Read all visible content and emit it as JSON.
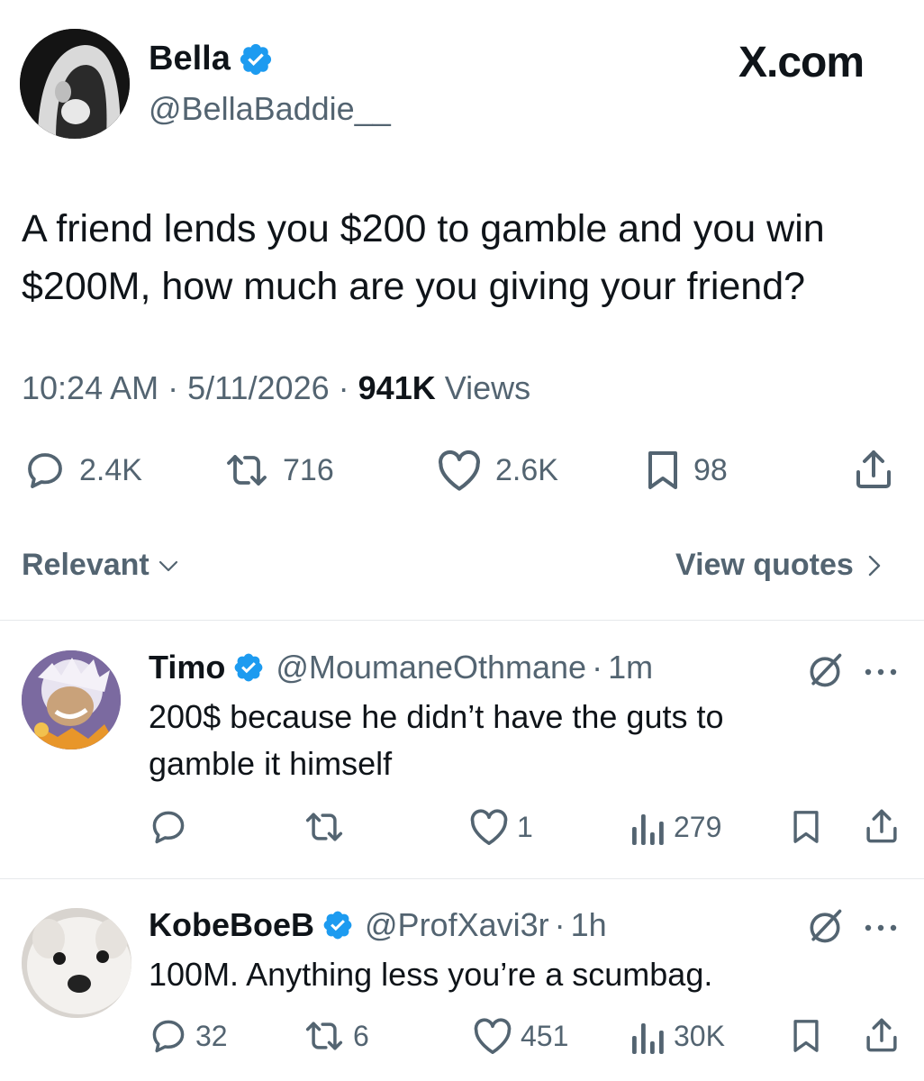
{
  "site": "X.com",
  "tweet": {
    "author_name": "Bella",
    "handle": "@BellaBaddie__",
    "text_line1": "A friend lends you $200 to gamble and you win",
    "text_line2": "$200M, how much are you giving your friend?",
    "time": "10:24 AM",
    "date": "5/11/2026",
    "views_count": "941K",
    "views_label": "Views",
    "sep": "·",
    "stats": {
      "replies": "2.4K",
      "reposts": "716",
      "likes": "2.6K",
      "bookmarks": "98"
    }
  },
  "filters": {
    "sort_label": "Relevant",
    "view_quotes_label": "View quotes"
  },
  "replies": [
    {
      "name": "Timo",
      "handle": "@MoumaneOthmane",
      "time": "1m",
      "text_line1": "200$ because he didn’t have the guts to",
      "text_line2": "gamble it himself",
      "likes": "1",
      "views": "279"
    },
    {
      "name": "KobeBoeB",
      "handle": "@ProfXavi3r",
      "time": "1h",
      "text_line1": "100M. Anything less you’re a scumbag.",
      "replies": "32",
      "reposts": "6",
      "likes": "451",
      "views": "30K"
    }
  ],
  "colors": {
    "verified": "#1d9bf0",
    "text": "#0f1419",
    "muted": "#536471"
  }
}
